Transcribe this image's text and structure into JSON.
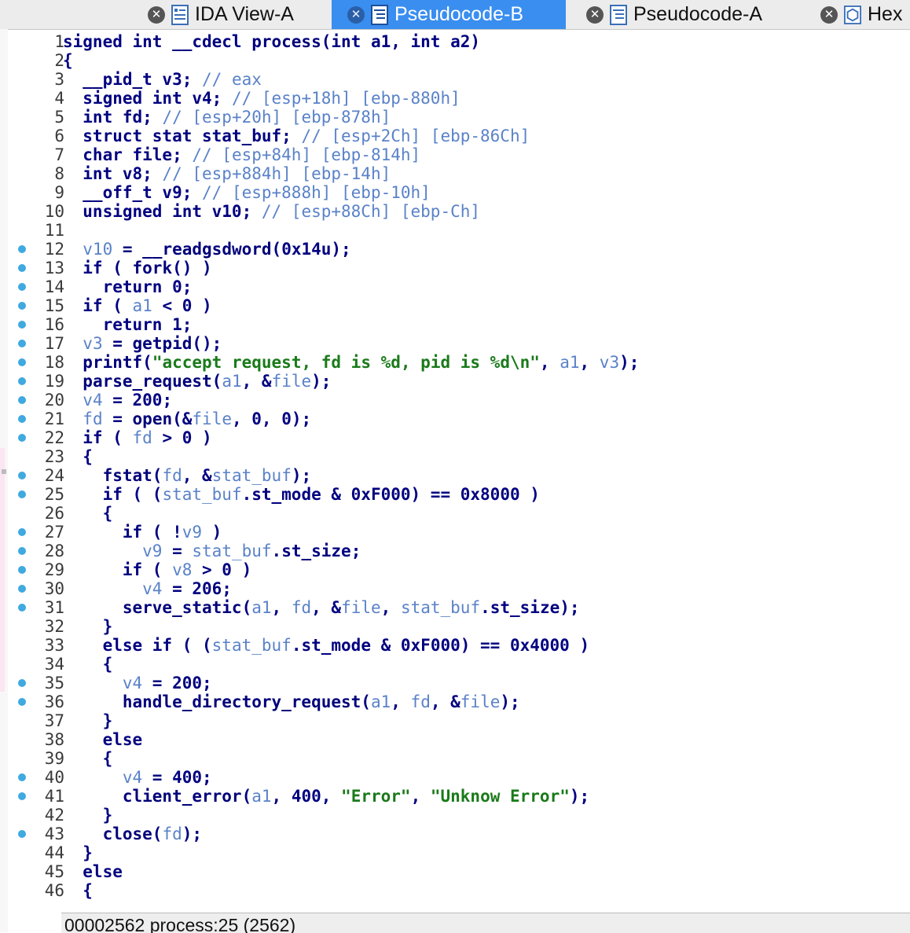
{
  "tabs": [
    {
      "label": "IDA View-A",
      "icon": "ida-view-icon",
      "active": false
    },
    {
      "label": "Pseudocode-B",
      "icon": "pseudocode-icon",
      "active": true
    },
    {
      "label": "Pseudocode-A",
      "icon": "pseudocode-icon",
      "active": false
    },
    {
      "label": "Hex",
      "icon": "hex-view-icon",
      "active": false
    }
  ],
  "status": "00002562 process:25 (2562)",
  "colors": {
    "active_tab": "#3a8ef0",
    "breakpoint_dot": "#3fa9e0",
    "keyword": "#000080",
    "variable": "#5a82c8",
    "string": "#1a7a1a"
  },
  "code": [
    {
      "n": "1",
      "dot": false,
      "t": "signed int __cdecl process(int a1, int a2)"
    },
    {
      "n": "2",
      "dot": false,
      "t": "{"
    },
    {
      "n": "3",
      "dot": false,
      "t": "  __pid_t v3; // eax"
    },
    {
      "n": "4",
      "dot": false,
      "t": "  signed int v4; // [esp+18h] [ebp-880h]"
    },
    {
      "n": "5",
      "dot": false,
      "t": "  int fd; // [esp+20h] [ebp-878h]"
    },
    {
      "n": "6",
      "dot": false,
      "t": "  struct stat stat_buf; // [esp+2Ch] [ebp-86Ch]"
    },
    {
      "n": "7",
      "dot": false,
      "t": "  char file; // [esp+84h] [ebp-814h]"
    },
    {
      "n": "8",
      "dot": false,
      "t": "  int v8; // [esp+884h] [ebp-14h]"
    },
    {
      "n": "9",
      "dot": false,
      "t": "  __off_t v9; // [esp+888h] [ebp-10h]"
    },
    {
      "n": "10",
      "dot": false,
      "t": "  unsigned int v10; // [esp+88Ch] [ebp-Ch]"
    },
    {
      "n": "11",
      "dot": false,
      "t": ""
    },
    {
      "n": "12",
      "dot": true,
      "t": "  v10 = __readgsdword(0x14u);"
    },
    {
      "n": "13",
      "dot": true,
      "t": "  if ( fork() )"
    },
    {
      "n": "14",
      "dot": true,
      "t": "    return 0;"
    },
    {
      "n": "15",
      "dot": true,
      "t": "  if ( a1 < 0 )"
    },
    {
      "n": "16",
      "dot": true,
      "t": "    return 1;"
    },
    {
      "n": "17",
      "dot": true,
      "t": "  v3 = getpid();"
    },
    {
      "n": "18",
      "dot": true,
      "t": "  printf(\"accept request, fd is %d, pid is %d\\n\", a1, v3);"
    },
    {
      "n": "19",
      "dot": true,
      "t": "  parse_request(a1, &file);"
    },
    {
      "n": "20",
      "dot": true,
      "t": "  v4 = 200;"
    },
    {
      "n": "21",
      "dot": true,
      "t": "  fd = open(&file, 0, 0);"
    },
    {
      "n": "22",
      "dot": true,
      "t": "  if ( fd > 0 )"
    },
    {
      "n": "23",
      "dot": false,
      "t": "  {"
    },
    {
      "n": "24",
      "dot": true,
      "t": "    fstat(fd, &stat_buf);"
    },
    {
      "n": "25",
      "dot": true,
      "t": "    if ( (stat_buf.st_mode & 0xF000) == 0x8000 )"
    },
    {
      "n": "26",
      "dot": false,
      "t": "    {"
    },
    {
      "n": "27",
      "dot": true,
      "t": "      if ( !v9 )"
    },
    {
      "n": "28",
      "dot": true,
      "t": "        v9 = stat_buf.st_size;"
    },
    {
      "n": "29",
      "dot": true,
      "t": "      if ( v8 > 0 )"
    },
    {
      "n": "30",
      "dot": true,
      "t": "        v4 = 206;"
    },
    {
      "n": "31",
      "dot": true,
      "t": "      serve_static(a1, fd, &file, stat_buf.st_size);"
    },
    {
      "n": "32",
      "dot": false,
      "t": "    }"
    },
    {
      "n": "33",
      "dot": false,
      "t": "    else if ( (stat_buf.st_mode & 0xF000) == 0x4000 )"
    },
    {
      "n": "34",
      "dot": false,
      "t": "    {"
    },
    {
      "n": "35",
      "dot": true,
      "t": "      v4 = 200;"
    },
    {
      "n": "36",
      "dot": true,
      "t": "      handle_directory_request(a1, fd, &file);"
    },
    {
      "n": "37",
      "dot": false,
      "t": "    }"
    },
    {
      "n": "38",
      "dot": false,
      "t": "    else"
    },
    {
      "n": "39",
      "dot": false,
      "t": "    {"
    },
    {
      "n": "40",
      "dot": true,
      "t": "      v4 = 400;"
    },
    {
      "n": "41",
      "dot": true,
      "t": "      client_error(a1, 400, \"Error\", \"Unknow Error\");"
    },
    {
      "n": "42",
      "dot": false,
      "t": "    }"
    },
    {
      "n": "43",
      "dot": true,
      "t": "    close(fd);"
    },
    {
      "n": "44",
      "dot": false,
      "t": "  }"
    },
    {
      "n": "45",
      "dot": false,
      "t": "  else"
    },
    {
      "n": "46",
      "dot": false,
      "t": "  {"
    }
  ]
}
